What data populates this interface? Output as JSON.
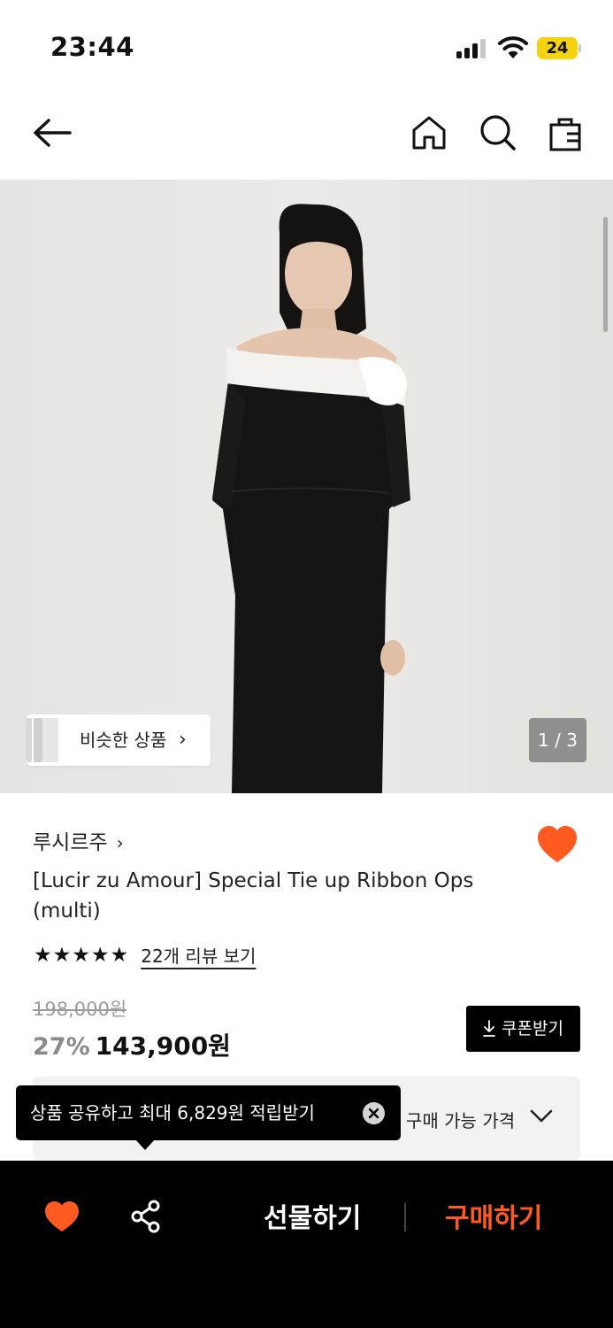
{
  "status_bar": {
    "time": "23:44",
    "battery": "24"
  },
  "gallery": {
    "similar_label": "비슷한 상품",
    "page_indicator": "1 / 3"
  },
  "product": {
    "brand": "루시르주",
    "title": "[Lucir zu Amour] Special Tie up Ribbon Ops (multi)",
    "rating_stars": 5,
    "review_link": "22개 리뷰 보기",
    "original_price": "198,000원",
    "discount": "27%",
    "price": "143,900원",
    "coupon_label": "쿠폰받기",
    "available_price_label": "구매 가능 가격"
  },
  "tooltip": {
    "text": "상품 공유하고 최대 6,829원 적립받기"
  },
  "bottom_bar": {
    "gift_label": "선물하기",
    "buy_label": "구매하기"
  },
  "colors": {
    "accent": "#ff5a1f",
    "battery": "#f5d311"
  },
  "icons": [
    "back-arrow-icon",
    "home-icon",
    "search-icon",
    "shopping-bag-icon",
    "heart-icon",
    "share-icon",
    "close-icon",
    "download-icon",
    "chevron-down-icon"
  ]
}
